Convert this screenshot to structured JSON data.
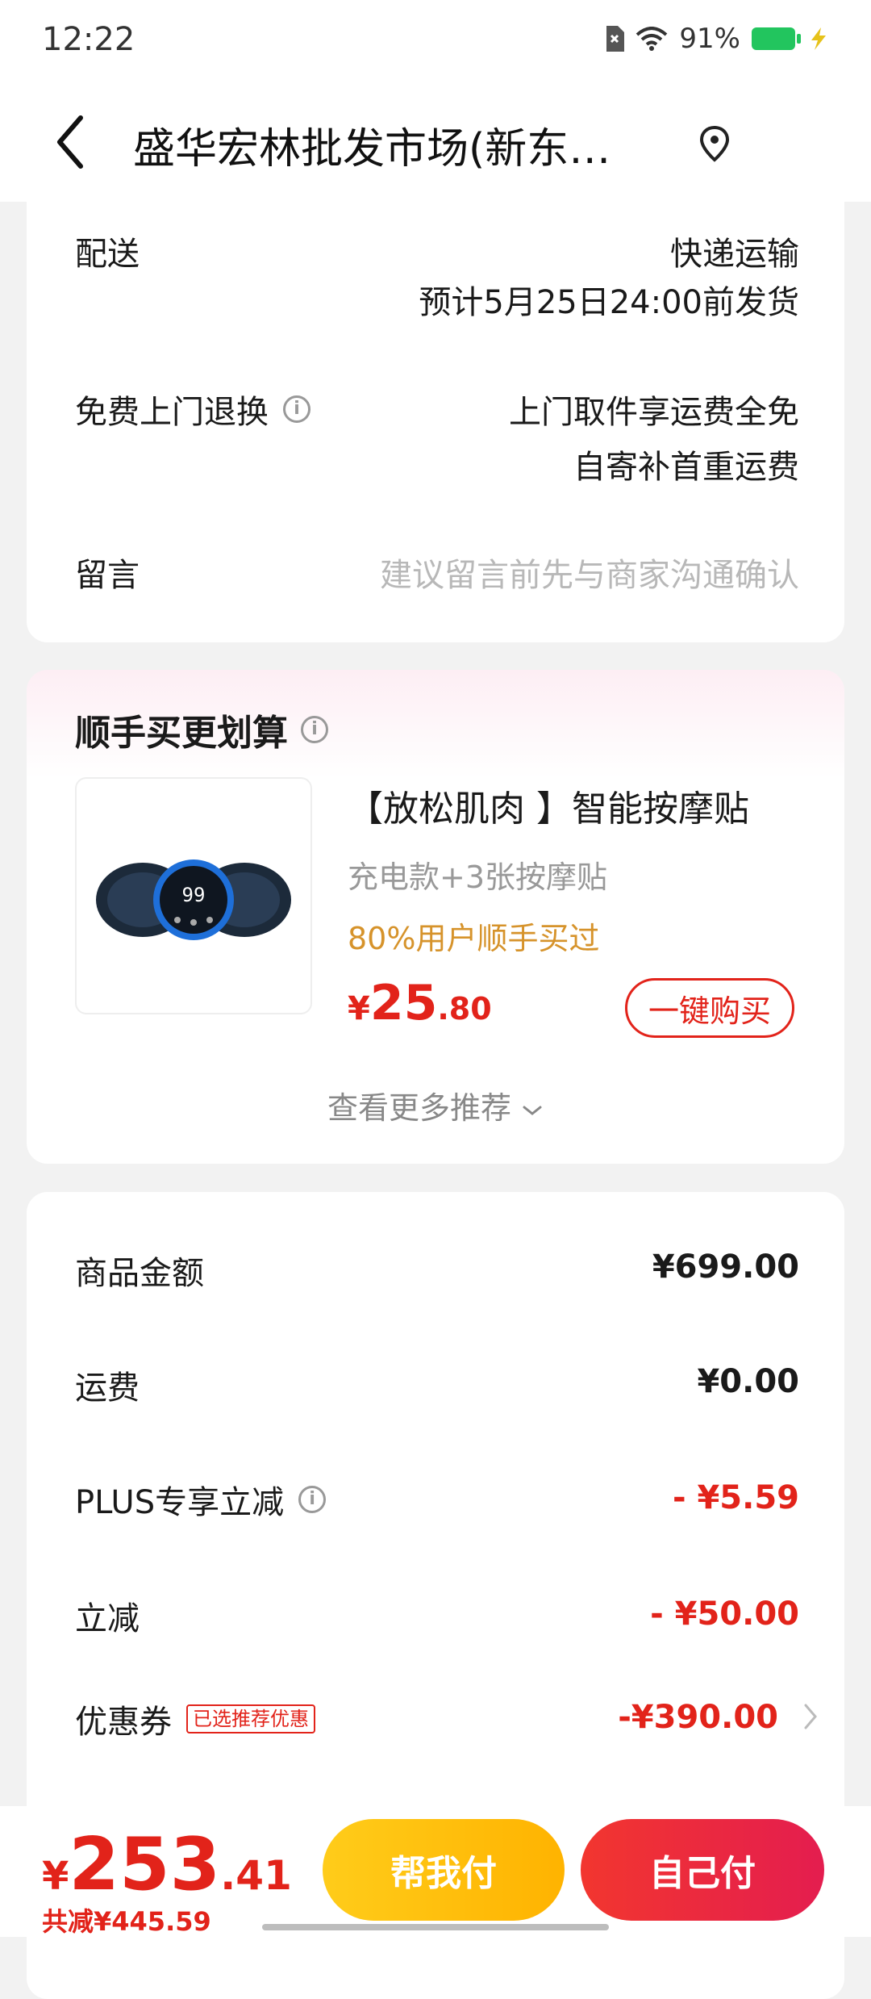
{
  "status_bar": {
    "time": "12:22",
    "battery": "91%"
  },
  "nav": {
    "title": "盛华宏林批发市场(新东…"
  },
  "delivery": {
    "label": "配送",
    "method": "快递运输",
    "eta": "预计5月25日24:00前发货"
  },
  "return": {
    "label": "免费上门退换",
    "line1": "上门取件享运费全免",
    "line2": "自寄补首重运费"
  },
  "message": {
    "label": "留言",
    "placeholder": "建议留言前先与商家沟通确认"
  },
  "recommend": {
    "title": "顺手买更划算",
    "product_name": "【放松肌肉 】智能按摩贴",
    "spec": "充电款+3张按摩贴",
    "social": "80%用户顺手买过",
    "price_currency": "¥",
    "price_int": "25",
    "price_dec": ".80",
    "buy_label": "一键购买",
    "more_label": "查看更多推荐",
    "device_display": "99"
  },
  "summary": {
    "goods_label": "商品金额",
    "goods_value": "¥699.00",
    "shipping_label": "运费",
    "shipping_value": "¥0.00",
    "plus_label": "PLUS专享立减",
    "plus_value": "- ¥5.59",
    "instant_label": "立减",
    "instant_value": "- ¥50.00",
    "coupon_label": "优惠券",
    "coupon_badge": "已选推荐优惠",
    "coupon_value": "-¥390.00"
  },
  "bottom": {
    "currency": "¥",
    "total_int": "253",
    "total_dec": ".41",
    "saved": "共减¥445.59",
    "help_pay": "帮我付",
    "self_pay": "自己付"
  },
  "colors": {
    "accent_red": "#e2231a",
    "help_yellow": "#ffc107",
    "social_orange": "#d6932b"
  }
}
